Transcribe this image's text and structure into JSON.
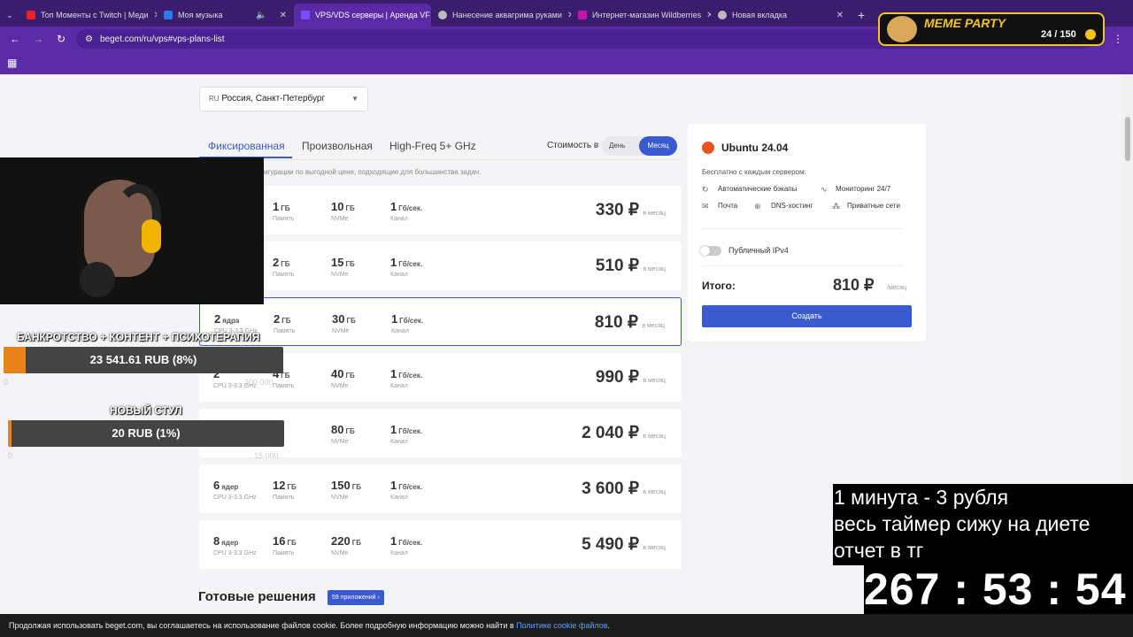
{
  "browser": {
    "tabs": [
      {
        "label": "Топ Моменты с Twitch | Меди",
        "color": "#e22"
      },
      {
        "label": "Моя музыка",
        "color": "#2a7bf0"
      },
      {
        "label": "VPS/VDS серверы | Аренда VF",
        "color": "#7c4dff"
      },
      {
        "label": "Нанесение аквагрима руками",
        "color": "#bbb"
      },
      {
        "label": "Интернет-магазин Wildberries",
        "color": "#cb11ab"
      },
      {
        "label": "Новая вкладка",
        "color": "#bbb"
      }
    ],
    "url": "beget.com/ru/vps#vps-plans-list",
    "meme_badge": "MEME PARTY",
    "meme_count": "24 / 150"
  },
  "region": {
    "flag": "RU",
    "label": "Россия, Санкт-Петербург"
  },
  "tabs": [
    "Фиксированная",
    "Произвольная",
    "High-Freq 5+ GHz"
  ],
  "cost_label": "Стоимость в",
  "cost_day": "День",
  "cost_month": "Месяц",
  "description": "е популярные конфигурации по выгодной цене, подходящие для большинства задач.",
  "plans": [
    {
      "cores": "",
      "core_unit": "",
      "cpu": "",
      "ram": "1",
      "disk": "10",
      "net": "1",
      "price": "330 ₽"
    },
    {
      "cores": "",
      "core_unit": "",
      "cpu": "",
      "ram": "2",
      "disk": "15",
      "net": "1",
      "price": "510 ₽"
    },
    {
      "cores": "2",
      "core_unit": "ядра",
      "cpu": "CPU 3-3.3 GHz",
      "ram": "2",
      "disk": "30",
      "net": "1",
      "price": "810 ₽"
    },
    {
      "cores": "2",
      "core_unit": "",
      "cpu": "CPU 3-3.3 GHz",
      "ram": "4",
      "disk": "40",
      "net": "1",
      "price": "990 ₽"
    },
    {
      "cores": "",
      "core_unit": "",
      "cpu": "",
      "ram": "",
      "disk": "80",
      "net": "1",
      "price": "2 040 ₽"
    },
    {
      "cores": "6",
      "core_unit": "ядер",
      "cpu": "CPU 3-3.3 GHz",
      "ram": "12",
      "disk": "150",
      "net": "1",
      "price": "3 600 ₽"
    },
    {
      "cores": "8",
      "core_unit": "ядер",
      "cpu": "CPU 3-3.3 GHz",
      "ram": "16",
      "disk": "220",
      "net": "1",
      "price": "5 490 ₽"
    }
  ],
  "units": {
    "ram": "ГБ",
    "ram_label": "Память",
    "disk": "ГБ",
    "disk_label": "NVMe",
    "net": "Гб/сек.",
    "net_label": "Канал",
    "per": "в месяц"
  },
  "ready": {
    "title": "Готовые решения",
    "badge": "59 приложений ›"
  },
  "sidebar": {
    "os": "Ubuntu 24.04",
    "free_label": "Бесплатно с каждым сервером:",
    "features": [
      "Автоматические бэкапы",
      "Мониторинг 24/7",
      "Почта",
      "DNS-хостинг",
      "Приватные сети"
    ],
    "ipv4": "Публичный IPv4",
    "total_label": "Итого:",
    "total_price": "810 ₽",
    "total_per": "/месяц",
    "create": "Создать"
  },
  "overlay": {
    "goal1_title": "БАНКРОТСТВО + КОНТЕНТ + ПСИХОТЕРАПИЯ",
    "goal1_value": "23 541.61 RUB (8%)",
    "goal1_progress": 0.08,
    "goal1_min": "0",
    "goal1_max": "300 000",
    "goal2_title": "НОВЫЙ СТУЛ",
    "goal2_value": "20 RUB (1%)",
    "goal2_progress": 0.01,
    "goal2_min": "0",
    "goal2_max": "15 000",
    "timer_line1": "1 минута - 3 рубля",
    "timer_line2": "весь таймер сижу на диете",
    "timer_line3": "отчет в тг",
    "timer": "267 : 53 : 54"
  },
  "cookie": {
    "text": "Продолжая использовать beget.com, вы соглашаетесь на использование файлов cookie. Более подробную информацию можно найти в ",
    "link": "Политике cookie файлов",
    "end": "."
  }
}
